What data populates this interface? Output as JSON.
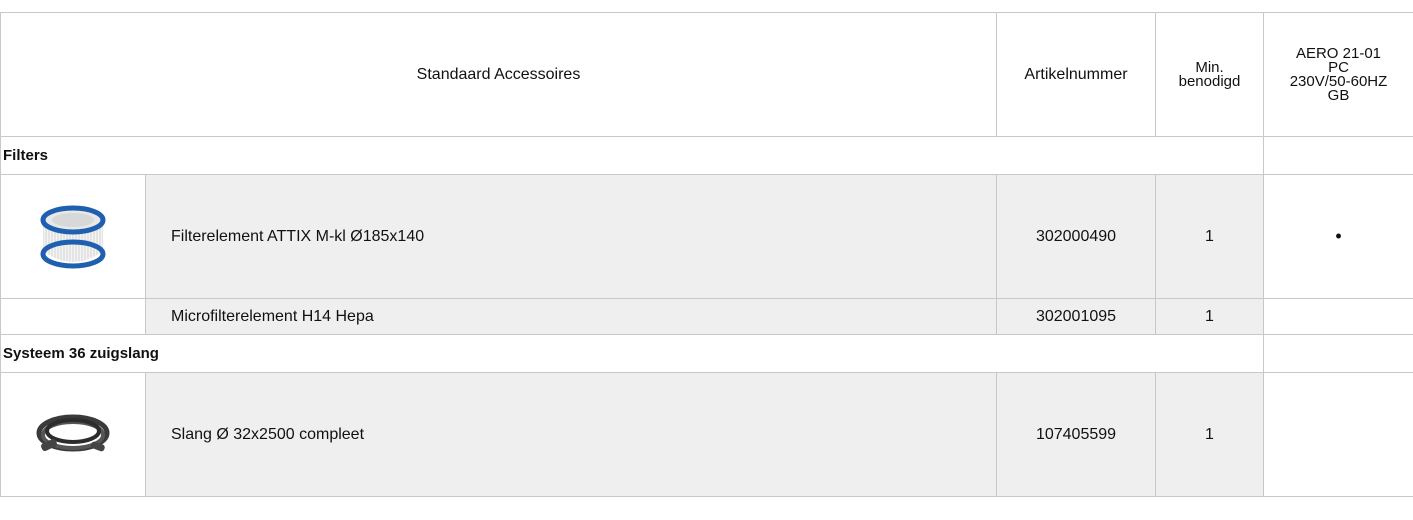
{
  "header": {
    "col_desc": "Standaard Accessoires",
    "col_article": "Artikelnummer",
    "col_min_line1": "Min.",
    "col_min_line2": "benodigd",
    "col_model_line1": "AERO 21-01",
    "col_model_line2": "PC",
    "col_model_line3": "230V/50-60HZ",
    "col_model_line4": "GB"
  },
  "sections": [
    {
      "category": "Filters",
      "items": [
        {
          "icon": "filter-element-icon",
          "name": "Filterelement ATTIX M-kl Ø185x140",
          "article": "302000490",
          "min": "1",
          "model_mark": "•"
        },
        {
          "icon": "",
          "name": "Microfilterelement H14 Hepa",
          "article": "302001095",
          "min": "1",
          "model_mark": ""
        }
      ]
    },
    {
      "category": "Systeem 36 zuigslang",
      "items": [
        {
          "icon": "hose-icon",
          "name": "Slang Ø 32x2500 compleet",
          "article": "107405599",
          "min": "1",
          "model_mark": ""
        }
      ]
    }
  ],
  "colors": {
    "row_bg": "#efefef",
    "border": "#c8c8c8",
    "filter_blue": "#1f5fb0"
  }
}
